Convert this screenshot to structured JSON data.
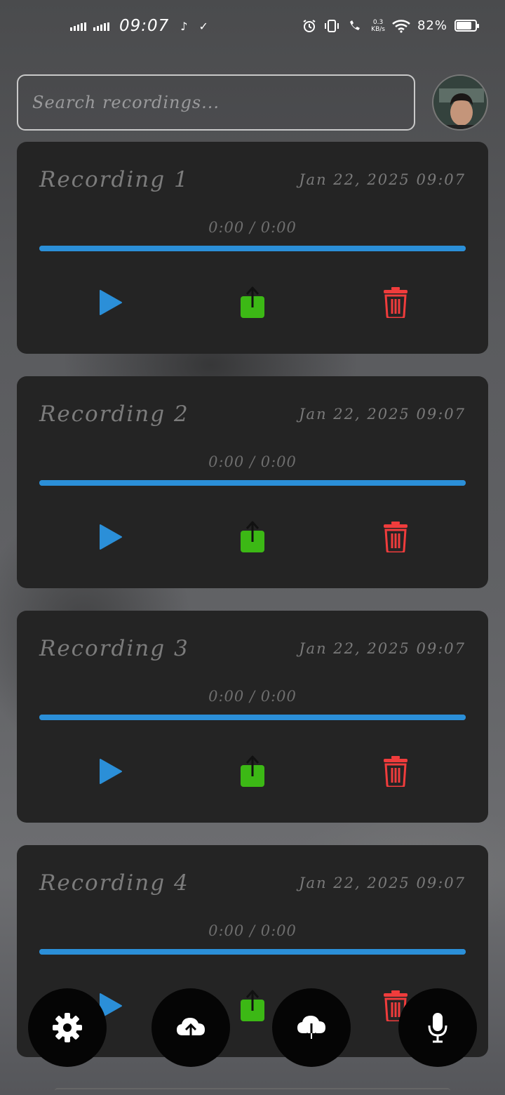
{
  "status_bar": {
    "time": "09:07",
    "net_speed_value": "0.3",
    "net_speed_unit": "KB/s",
    "battery_percent": "82%",
    "battery_level": 0.82
  },
  "search": {
    "placeholder": "Search recordings..."
  },
  "recordings": [
    {
      "title": "Recording 1",
      "date": "Jan 22, 2025 09:07",
      "time": "0:00 / 0:00",
      "progress": 1.0
    },
    {
      "title": "Recording 2",
      "date": "Jan 22, 2025 09:07",
      "time": "0:00 / 0:00",
      "progress": 1.0
    },
    {
      "title": "Recording 3",
      "date": "Jan 22, 2025 09:07",
      "time": "0:00 / 0:00",
      "progress": 1.0
    },
    {
      "title": "Recording 4",
      "date": "Jan 22, 2025 09:07",
      "time": "0:00 / 0:00",
      "progress": 1.0
    }
  ],
  "icons": {
    "play": "play-icon",
    "share": "share-icon",
    "delete": "trash-icon",
    "settings": "gear-icon",
    "upload": "cloud-upload-icon",
    "download": "cloud-download-icon",
    "record": "microphone-icon"
  },
  "colors": {
    "play": "#2b8fd8",
    "share": "#3cb815",
    "delete": "#f03c3c",
    "progress": "#2b8fd8",
    "card": "#242424",
    "fab": "#050505"
  }
}
